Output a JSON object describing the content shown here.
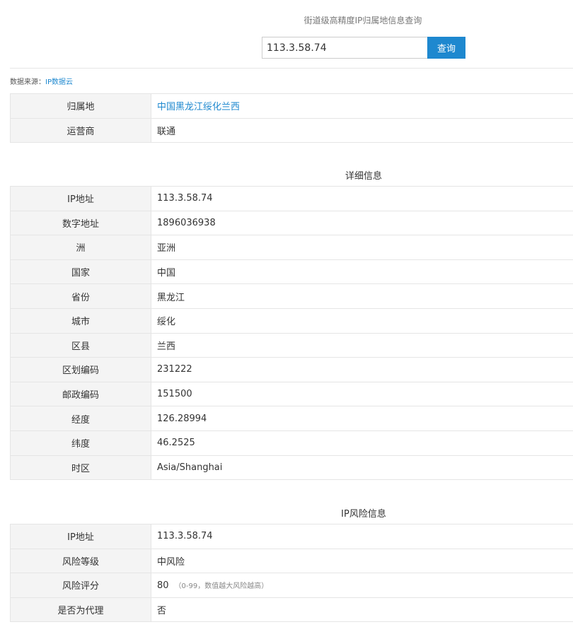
{
  "header": {
    "title": "街道级高精度IP归属地信息查询"
  },
  "search": {
    "value": "113.3.58.74",
    "button_label": "查询"
  },
  "source": {
    "label": "数据来源：",
    "link_text": "IP数据云"
  },
  "summary": {
    "rows": [
      {
        "label": "归属地",
        "value": "中国黑龙江绥化兰西"
      },
      {
        "label": "运营商",
        "value": "联通"
      }
    ]
  },
  "detail": {
    "title": "详细信息",
    "rows": [
      {
        "label": "IP地址",
        "value": "113.3.58.74"
      },
      {
        "label": "数字地址",
        "value": "1896036938"
      },
      {
        "label": "洲",
        "value": "亚洲"
      },
      {
        "label": "国家",
        "value": "中国"
      },
      {
        "label": "省份",
        "value": "黑龙江"
      },
      {
        "label": "城市",
        "value": "绥化"
      },
      {
        "label": "区县",
        "value": "兰西"
      },
      {
        "label": "区划编码",
        "value": "231222"
      },
      {
        "label": "邮政编码",
        "value": "151500"
      },
      {
        "label": "经度",
        "value": "126.28994"
      },
      {
        "label": "纬度",
        "value": "46.2525"
      },
      {
        "label": "时区",
        "value": "Asia/Shanghai"
      }
    ]
  },
  "risk": {
    "title": "IP风险信息",
    "rows": [
      {
        "label": "IP地址",
        "value": "113.3.58.74"
      },
      {
        "label": "风险等级",
        "value": "中风险"
      },
      {
        "label": "风险评分",
        "value": "80",
        "hint": "（0-99，数值越大风险越高）"
      },
      {
        "label": "是否为代理",
        "value": "否"
      }
    ]
  },
  "colors": {
    "accent": "#1e88cf",
    "label_bg": "#f4f4f4",
    "border": "#e5e5e5"
  }
}
